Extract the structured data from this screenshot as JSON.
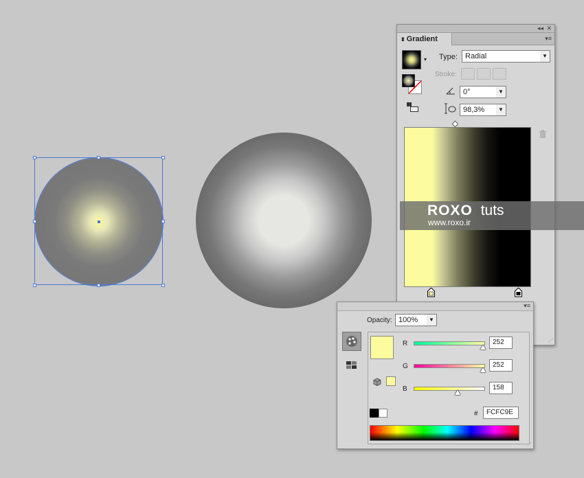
{
  "gradient_panel": {
    "title": "Gradient",
    "collapse_glyph": "◂◂",
    "close_glyph": "✕",
    "menu_glyph": "▾≡",
    "type_label": "Type:",
    "type_value": "Radial",
    "stroke_label": "Stroke:",
    "angle_value": "0°",
    "aspect_value": "98,3%"
  },
  "watermark": {
    "brand": "ROXO",
    "suffix": "tuts",
    "url": "www.roxo.ir"
  },
  "color_panel": {
    "menu_glyph": "▾≡",
    "opacity_label": "Opacity:",
    "opacity_value": "100%",
    "r_label": "R",
    "g_label": "G",
    "b_label": "B",
    "r_value": "252",
    "g_value": "252",
    "b_value": "158",
    "hash_label": "#",
    "hex_value": "FCFC9E"
  },
  "colors": {
    "selected_stop": "#fcfc9e",
    "selection_blue": "#4a78d6",
    "panel_bg": "#d6d6d6"
  },
  "icons": [
    "gradient-swatch-icon",
    "fill-stroke-icon",
    "reverse-gradient-icon",
    "angle-icon",
    "aspect-ratio-icon",
    "trash-icon",
    "color-mode-icon",
    "swatches-icon",
    "gamut-cube-icon"
  ]
}
